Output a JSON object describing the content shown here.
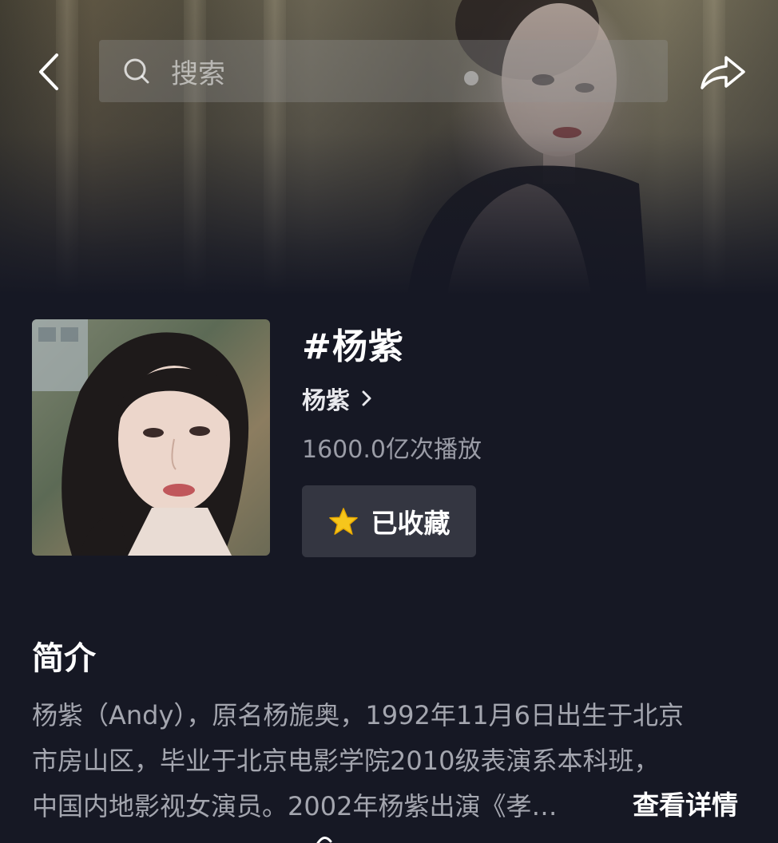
{
  "header": {
    "search_placeholder": "搜索",
    "icons": {
      "back": "back-arrow-icon",
      "search": "search-icon",
      "share": "share-arrow-icon"
    }
  },
  "topic": {
    "title": "#杨紫",
    "subject_name": "杨紫",
    "plays": "1600.0亿次播放",
    "favorite_label": "已收藏",
    "favorite_icon": "star-icon",
    "favorite_icon_color": "#F6C61C"
  },
  "intro": {
    "heading": "简介",
    "lines": [
      "杨紫（Andy），原名杨旎奥，1992年11月6日出生于北京",
      "市房山区，毕业于北京电影学院2010级表演系本科班，",
      "中国内地影视女演员。2002年杨紫出演《孝…"
    ],
    "more_label": "查看详情"
  },
  "colors": {
    "background": "#161824",
    "button_bg": "#343641",
    "muted_text": "#9a9ca6"
  }
}
